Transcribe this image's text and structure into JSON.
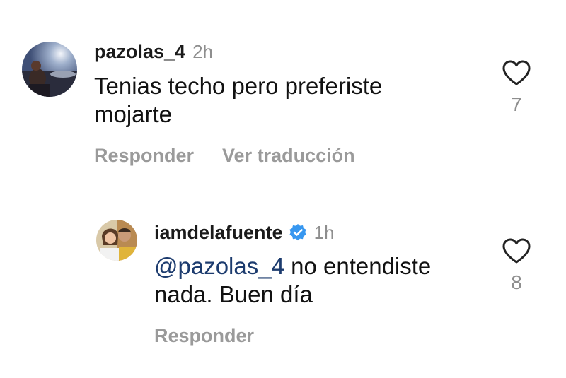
{
  "comments": [
    {
      "username": "pazolas_4",
      "time": "2h",
      "verified": false,
      "text_lines": [
        "Tenias techo pero preferiste",
        "mojarte"
      ],
      "actions": [
        "Responder",
        "Ver traducción"
      ],
      "likes": "7"
    },
    {
      "username": "iamdelafuente",
      "time": "1h",
      "verified": true,
      "mention": "@pazolas_4",
      "text_after_mention": " no entendiste",
      "text_line2": "nada. Buen día",
      "actions": [
        "Responder"
      ],
      "likes": "8"
    }
  ],
  "colors": {
    "verified_badge": "#3797f0",
    "mention": "#1c3b6e",
    "secondary_text": "#8e8e8e"
  },
  "icons": {
    "like": "heart-outline-icon",
    "verified": "verified-badge-icon"
  }
}
